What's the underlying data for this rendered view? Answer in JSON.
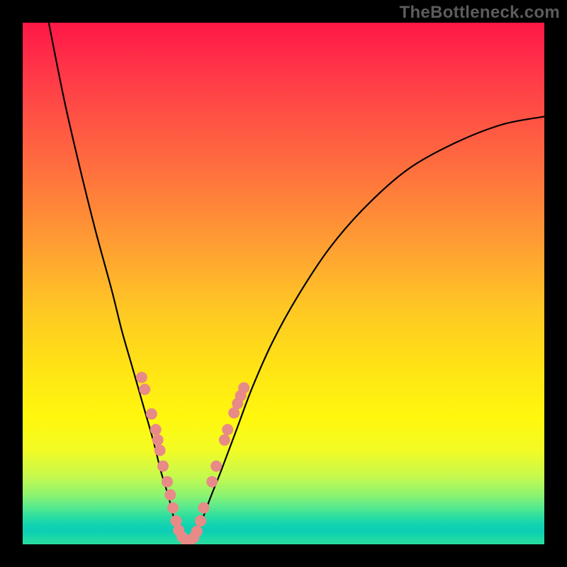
{
  "watermark": "TheBottleneck.com",
  "chart_data": {
    "type": "line",
    "title": "",
    "xlabel": "",
    "ylabel": "",
    "xlim": [
      0,
      100
    ],
    "ylim": [
      0,
      100
    ],
    "grid": false,
    "legend": false,
    "series": [
      {
        "name": "bottleneck-curve",
        "color": "#000000",
        "x": [
          5,
          8,
          11,
          14,
          17,
          19,
          21,
          23,
          25,
          26.5,
          28,
          29,
          30,
          31.5,
          33,
          34.5,
          36,
          38,
          41,
          44,
          48,
          53,
          59,
          66,
          74,
          83,
          92,
          100
        ],
        "y": [
          100,
          85,
          72,
          60,
          49,
          41,
          34,
          27,
          20,
          14,
          9,
          5,
          2,
          0.5,
          2,
          5,
          9,
          14,
          22,
          30,
          39,
          48,
          57,
          65,
          72,
          77,
          80.5,
          82
        ]
      }
    ],
    "markers": {
      "name": "highlight-dots",
      "color": "#e88a87",
      "radius_px": 8,
      "points": [
        {
          "x": 22.8,
          "y": 32
        },
        {
          "x": 23.4,
          "y": 29.7
        },
        {
          "x": 24.7,
          "y": 25
        },
        {
          "x": 25.5,
          "y": 22
        },
        {
          "x": 25.9,
          "y": 20
        },
        {
          "x": 26.3,
          "y": 18
        },
        {
          "x": 26.9,
          "y": 15
        },
        {
          "x": 27.7,
          "y": 12
        },
        {
          "x": 28.3,
          "y": 9.5
        },
        {
          "x": 28.8,
          "y": 7
        },
        {
          "x": 29.4,
          "y": 4.5
        },
        {
          "x": 29.9,
          "y": 2.7
        },
        {
          "x": 30.6,
          "y": 1.4
        },
        {
          "x": 31.3,
          "y": 0.7
        },
        {
          "x": 32.1,
          "y": 0.7
        },
        {
          "x": 32.8,
          "y": 1.3
        },
        {
          "x": 33.4,
          "y": 2.5
        },
        {
          "x": 34.1,
          "y": 4.5
        },
        {
          "x": 34.7,
          "y": 7
        },
        {
          "x": 36.3,
          "y": 12
        },
        {
          "x": 37.1,
          "y": 15
        },
        {
          "x": 38.7,
          "y": 20
        },
        {
          "x": 39.3,
          "y": 22
        },
        {
          "x": 40.5,
          "y": 25.2
        },
        {
          "x": 41.2,
          "y": 27
        },
        {
          "x": 41.8,
          "y": 28.5
        },
        {
          "x": 42.4,
          "y": 30
        }
      ]
    },
    "gradient_stops": [
      {
        "pos": 0.0,
        "color": "#ff1746"
      },
      {
        "pos": 0.15,
        "color": "#ff4846"
      },
      {
        "pos": 0.42,
        "color": "#ff9c33"
      },
      {
        "pos": 0.67,
        "color": "#ffe514"
      },
      {
        "pos": 0.87,
        "color": "#c6f94e"
      },
      {
        "pos": 0.95,
        "color": "#26dca4"
      },
      {
        "pos": 1.0,
        "color": "#27dd9f"
      }
    ]
  }
}
